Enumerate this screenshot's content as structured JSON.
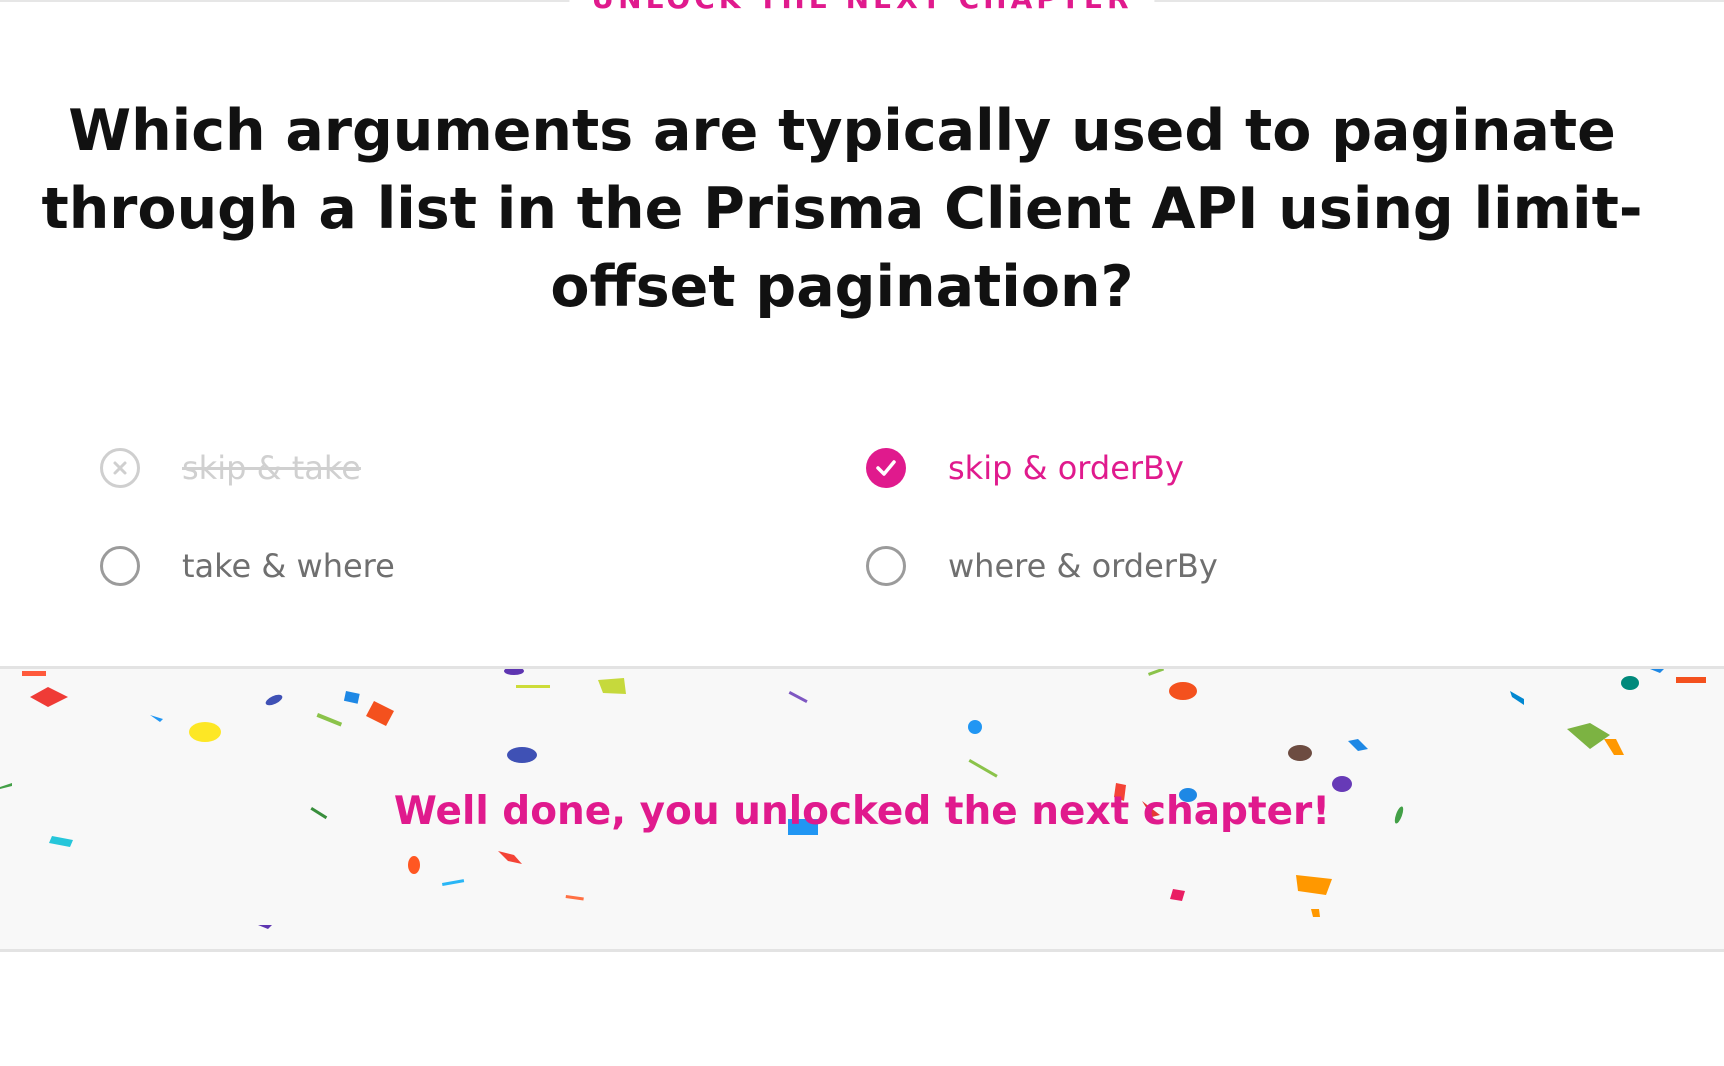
{
  "header": {
    "chapter_label": "UNLOCK THE NEXT CHAPTER"
  },
  "quiz": {
    "question": "Which arguments are typically used to paginate through a list in the Prisma Client API using limit-offset pagination?",
    "options": [
      {
        "label": "skip & take",
        "state": "wrong"
      },
      {
        "label": "skip & orderBy",
        "state": "correct"
      },
      {
        "label": "take & where",
        "state": "unselected"
      },
      {
        "label": "where & orderBy",
        "state": "unselected"
      }
    ]
  },
  "result": {
    "message": "Well done, you unlocked the next chapter!"
  },
  "colors": {
    "accent": "#e01a8d",
    "muted": "#d0d0d0",
    "text": "#111111",
    "option_text": "#6f6f6f",
    "banner_bg": "#f8f8f8"
  },
  "icons": {
    "wrong": "x-circle-icon",
    "correct": "check-circle-icon",
    "empty": "radio-empty-icon",
    "decoration": "confetti"
  }
}
